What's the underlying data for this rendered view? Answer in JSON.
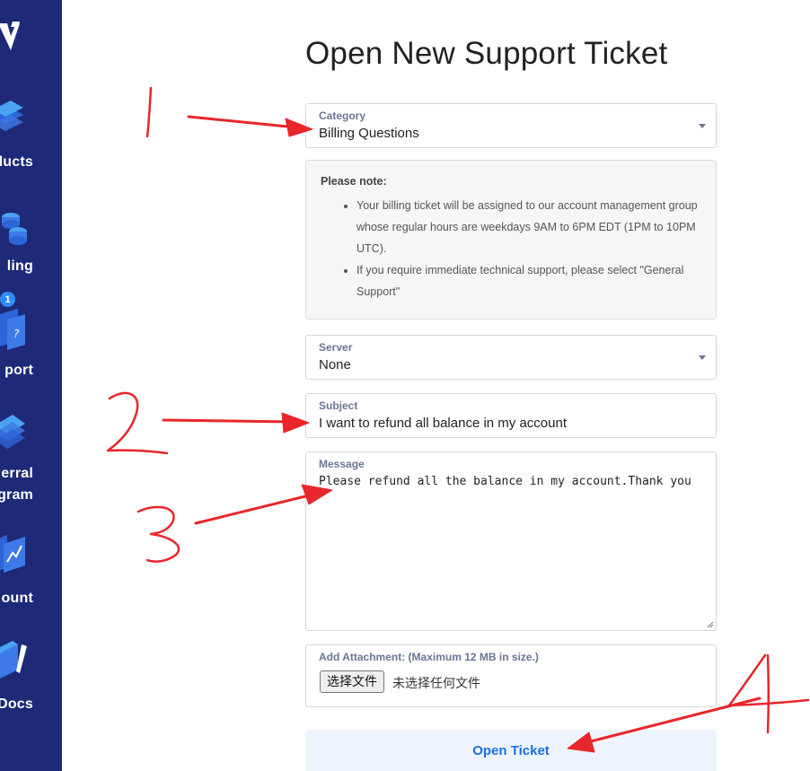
{
  "sidebar": {
    "badge": "1",
    "items": [
      {
        "label": "ducts",
        "icon": "products-icon"
      },
      {
        "label": "ling",
        "icon": "billing-icon"
      },
      {
        "label": "port",
        "icon": "support-icon"
      },
      {
        "label": "erral",
        "label2": "gram",
        "icon": "referral-icon"
      },
      {
        "label": "ount",
        "icon": "account-icon"
      },
      {
        "label": "Docs",
        "icon": "docs-icon"
      }
    ]
  },
  "form": {
    "title": "Open New Support Ticket",
    "category": {
      "label": "Category",
      "value": "Billing Questions"
    },
    "note": {
      "title": "Please note:",
      "bullets": [
        "Your billing ticket will be assigned to our account management group whose regular hours are weekdays 9AM to 6PM EDT (1PM to 10PM UTC).",
        "If you require immediate technical support, please select \"General Support\""
      ]
    },
    "server": {
      "label": "Server",
      "value": "None"
    },
    "subject": {
      "label": "Subject",
      "value": "I want to refund all balance in my account"
    },
    "message": {
      "label": "Message",
      "value": "Please refund all the balance in my account.Thank you"
    },
    "attachment": {
      "label": "Add Attachment: (Maximum 12 MB in size.)",
      "button": "选择文件",
      "status": "未选择任何文件"
    },
    "submit_label": "Open Ticket"
  },
  "colors": {
    "sidebar": "#1e2a78",
    "accent": "#1a6fe0",
    "annotation": "#e8262b"
  }
}
